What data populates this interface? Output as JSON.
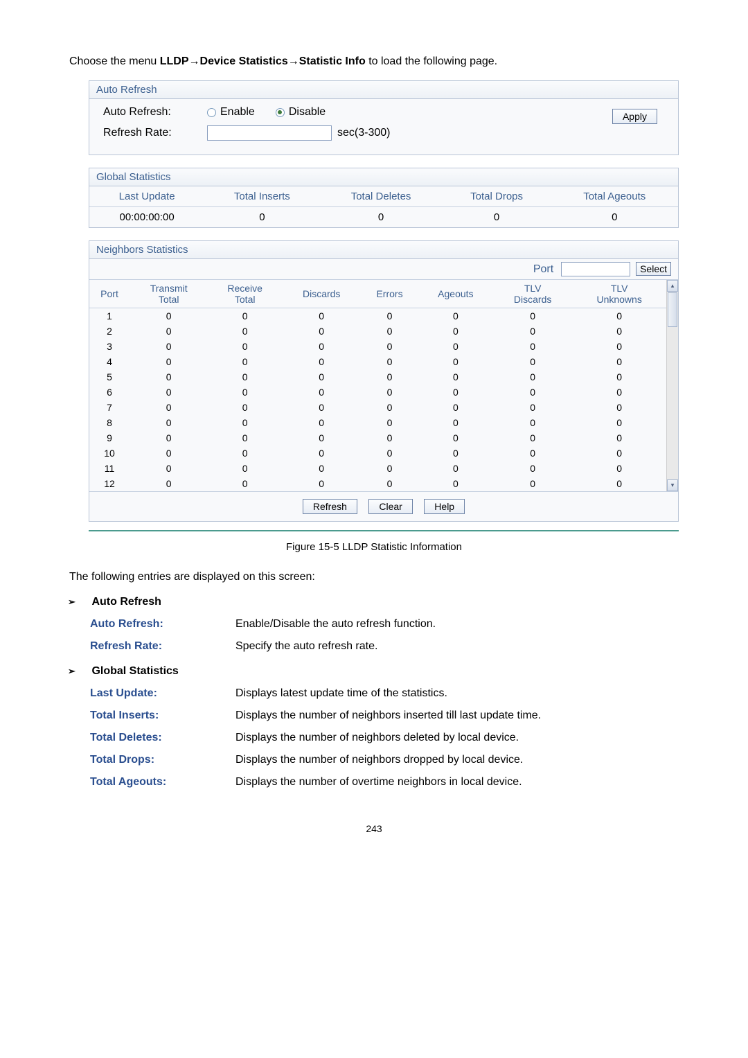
{
  "intro": {
    "prefix": "Choose the menu ",
    "breadcrumb_parts": [
      "LLDP",
      "Device Statistics",
      "Statistic Info"
    ],
    "suffix": " to load the following page."
  },
  "auto_refresh_panel": {
    "title": "Auto Refresh",
    "auto_refresh_label": "Auto Refresh:",
    "enable_label": "Enable",
    "disable_label": "Disable",
    "refresh_rate_label": "Refresh Rate:",
    "refresh_rate_unit": "sec(3-300)",
    "apply_label": "Apply",
    "selected": "disable"
  },
  "global_stats": {
    "title": "Global Statistics",
    "headers": [
      "Last Update",
      "Total Inserts",
      "Total Deletes",
      "Total Drops",
      "Total Ageouts"
    ],
    "values": [
      "00:00:00:00",
      "0",
      "0",
      "0",
      "0"
    ]
  },
  "neighbors": {
    "title": "Neighbors Statistics",
    "port_filter_label": "Port",
    "select_label": "Select",
    "headers": [
      "Port",
      "Transmit Total",
      "Receive Total",
      "Discards",
      "Errors",
      "Ageouts",
      "TLV Discards",
      "TLV Unknowns"
    ],
    "rows": [
      [
        "1",
        "0",
        "0",
        "0",
        "0",
        "0",
        "0",
        "0"
      ],
      [
        "2",
        "0",
        "0",
        "0",
        "0",
        "0",
        "0",
        "0"
      ],
      [
        "3",
        "0",
        "0",
        "0",
        "0",
        "0",
        "0",
        "0"
      ],
      [
        "4",
        "0",
        "0",
        "0",
        "0",
        "0",
        "0",
        "0"
      ],
      [
        "5",
        "0",
        "0",
        "0",
        "0",
        "0",
        "0",
        "0"
      ],
      [
        "6",
        "0",
        "0",
        "0",
        "0",
        "0",
        "0",
        "0"
      ],
      [
        "7",
        "0",
        "0",
        "0",
        "0",
        "0",
        "0",
        "0"
      ],
      [
        "8",
        "0",
        "0",
        "0",
        "0",
        "0",
        "0",
        "0"
      ],
      [
        "9",
        "0",
        "0",
        "0",
        "0",
        "0",
        "0",
        "0"
      ],
      [
        "10",
        "0",
        "0",
        "0",
        "0",
        "0",
        "0",
        "0"
      ],
      [
        "11",
        "0",
        "0",
        "0",
        "0",
        "0",
        "0",
        "0"
      ],
      [
        "12",
        "0",
        "0",
        "0",
        "0",
        "0",
        "0",
        "0"
      ]
    ],
    "refresh_label": "Refresh",
    "clear_label": "Clear",
    "help_label": "Help"
  },
  "caption": "Figure 15-5 LLDP Statistic Information",
  "entries_intro": "The following entries are displayed on this screen:",
  "sections": {
    "auto_refresh": {
      "title": "Auto Refresh",
      "items": [
        {
          "label": "Auto Refresh:",
          "desc": "Enable/Disable the auto refresh function."
        },
        {
          "label": "Refresh Rate:",
          "desc": "Specify the auto refresh rate."
        }
      ]
    },
    "global": {
      "title": "Global Statistics",
      "items": [
        {
          "label": "Last Update:",
          "desc": "Displays latest update time of the statistics."
        },
        {
          "label": "Total Inserts:",
          "desc": "Displays the number of neighbors inserted till last update time."
        },
        {
          "label": "Total Deletes:",
          "desc": "Displays the number of neighbors deleted by local device."
        },
        {
          "label": "Total Drops:",
          "desc": "Displays the number of neighbors dropped by local device."
        },
        {
          "label": "Total Ageouts:",
          "desc": "Displays the number of overtime neighbors in local device."
        }
      ]
    }
  },
  "page_number": "243"
}
